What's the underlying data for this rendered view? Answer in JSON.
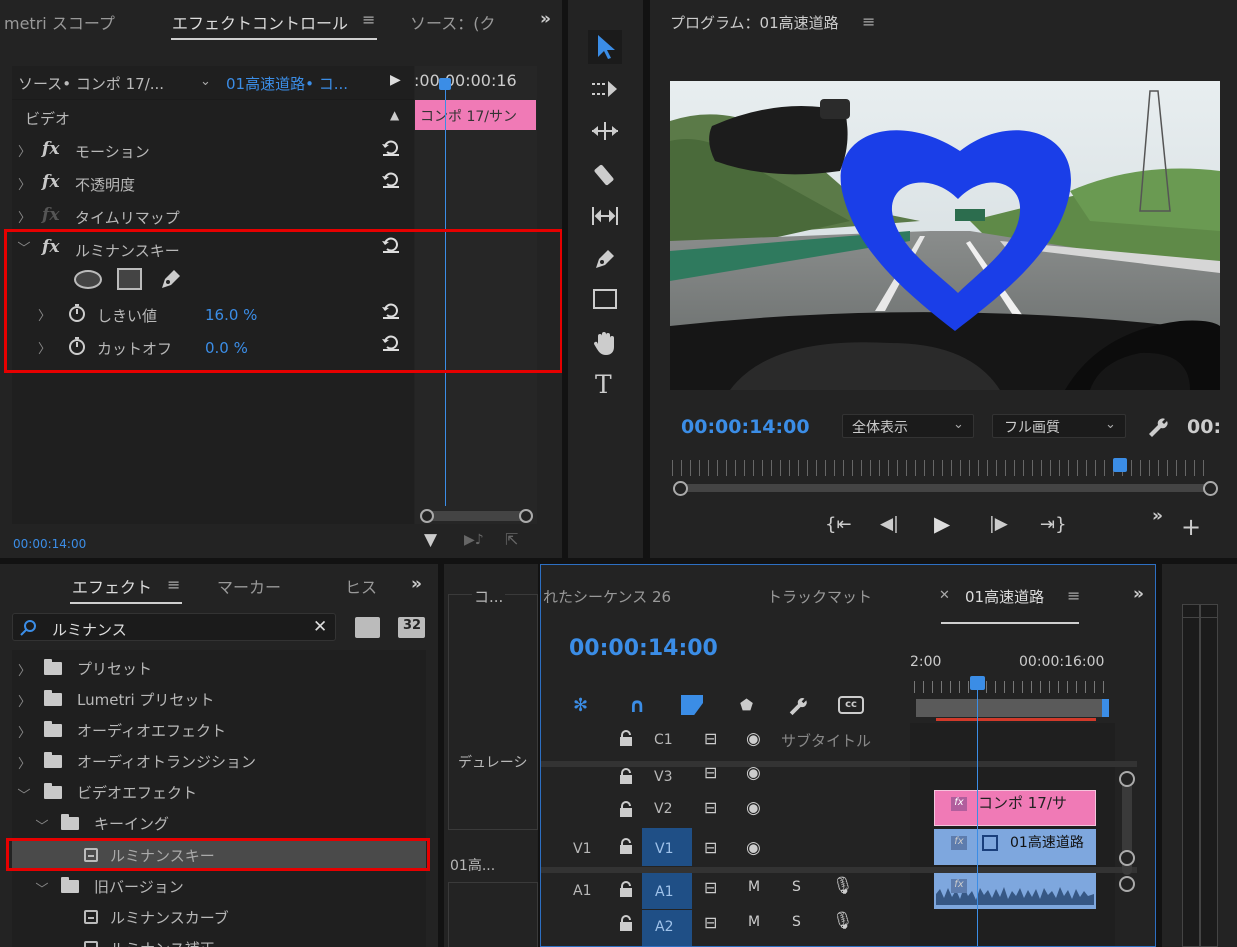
{
  "effect_controls": {
    "tabs": [
      "metri スコープ",
      "エフェクトコントロール",
      "ソース：(ク"
    ],
    "source_label": "ソース• コンポ 17/...",
    "clip_label": "01高速道路• コ...",
    "timecode_ruler": ":00 00:00:16",
    "clip_bar": "コンポ 17/サン",
    "section_video": "ビデオ",
    "effects": [
      "モーション",
      "不透明度",
      "タイムリマップ",
      "ルミナンスキー"
    ],
    "params": [
      {
        "name": "しきい値",
        "value": "16.0 %"
      },
      {
        "name": "カットオフ",
        "value": "0.0 %"
      }
    ],
    "timecode": "00:00:14:00"
  },
  "program": {
    "title": "プログラム：01高速道路",
    "timecode": "00:00:14:00",
    "zoom": "全体表示",
    "quality": "フル画質",
    "timecode_right": "00:"
  },
  "effects_panel": {
    "tabs": [
      "エフェクト",
      "マーカー",
      "ヒス"
    ],
    "search_value": "ルミナンス",
    "badge_32": "32",
    "tree": [
      {
        "label": "プリセット",
        "level": 0,
        "kind": "star-folder",
        "expanded": false
      },
      {
        "label": "Lumetri プリセット",
        "level": 0,
        "kind": "star-folder",
        "expanded": false
      },
      {
        "label": "オーディオエフェクト",
        "level": 0,
        "kind": "folder",
        "expanded": false
      },
      {
        "label": "オーディオトランジション",
        "level": 0,
        "kind": "folder",
        "expanded": false
      },
      {
        "label": "ビデオエフェクト",
        "level": 0,
        "kind": "folder",
        "expanded": true
      },
      {
        "label": "キーイング",
        "level": 1,
        "kind": "folder",
        "expanded": true
      },
      {
        "label": "ルミナンスキー",
        "level": 2,
        "kind": "effect",
        "selected": true
      },
      {
        "label": "旧バージョン",
        "level": 1,
        "kind": "folder",
        "expanded": true
      },
      {
        "label": "ルミナンスカーブ",
        "level": 2,
        "kind": "effect"
      },
      {
        "label": "ルミナンス補正",
        "level": 2,
        "kind": "effect"
      }
    ]
  },
  "middle_panel": {
    "title": "コ...",
    "label_duration": "デュレーシ",
    "clip": "01高..."
  },
  "timeline": {
    "tabs": [
      "れたシーケンス 26",
      "トラックマット",
      "01高速道路"
    ],
    "timecode": "00:00:14:00",
    "ruler_left": "2:00",
    "ruler_right": "00:00:16:00",
    "tracks": [
      {
        "id": "C1",
        "label": "サブタイトル"
      },
      {
        "id": "V3"
      },
      {
        "id": "V2"
      },
      {
        "id": "V1",
        "source": "V1"
      },
      {
        "id": "A1",
        "source": "A1",
        "m": "M",
        "s": "S"
      },
      {
        "id": "A2",
        "m": "M",
        "s": "S"
      }
    ],
    "clips": {
      "v2": "コンポ 17/サ",
      "v1": "01高速道路"
    }
  },
  "colors": {
    "accent": "#3b8de6",
    "highlight": "#e60000",
    "clip_pink": "#f27ab5",
    "clip_blue": "#7ea7de",
    "heart": "#1a3ee8"
  }
}
